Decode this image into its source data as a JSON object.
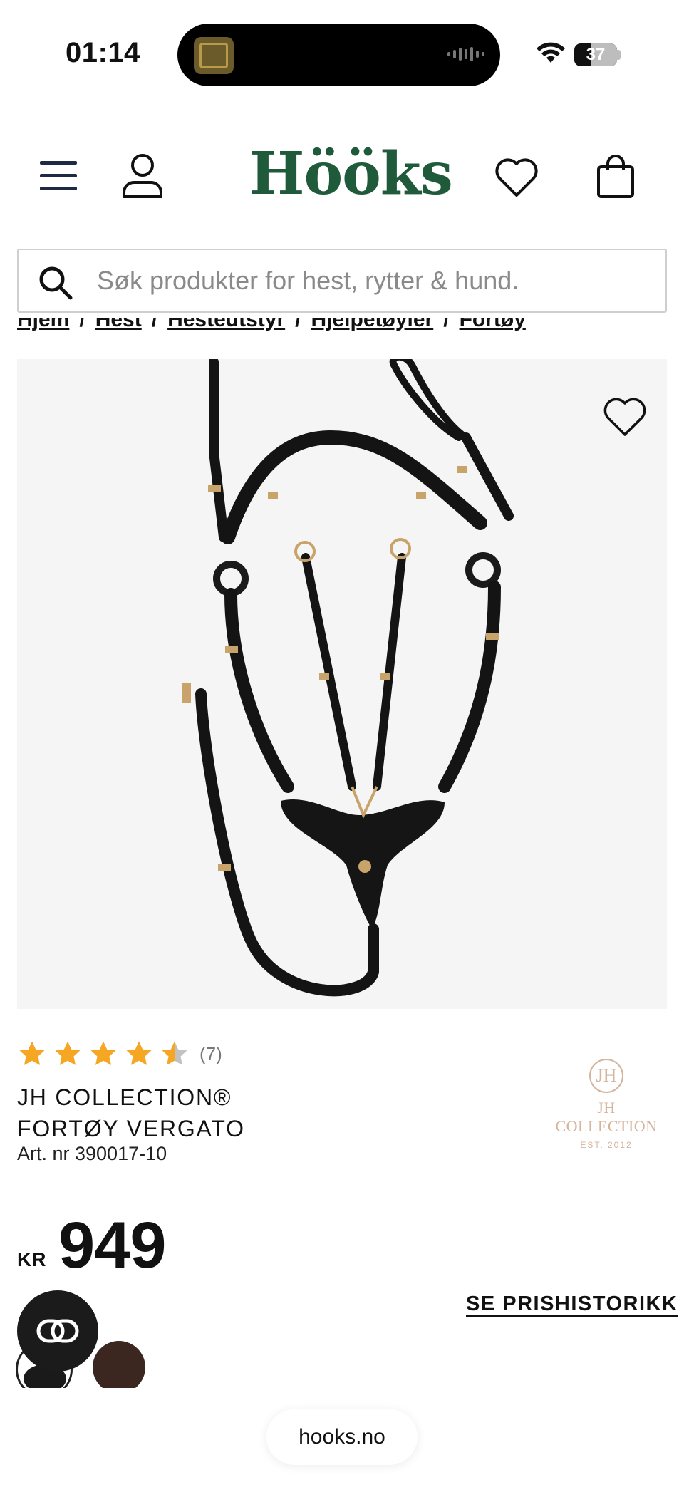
{
  "status": {
    "time": "01:14",
    "battery": "37"
  },
  "header": {
    "logo": "Hööks"
  },
  "search": {
    "placeholder": "Søk produkter for hest, rytter & hund."
  },
  "breadcrumb": [
    "Hjem",
    "Hest",
    "Hesteutstyr",
    "Hjelpetøyler",
    "Fortøy"
  ],
  "product": {
    "rating_stars": 4.5,
    "rating_count": "(7)",
    "title_line1": "JH COLLECTION®",
    "title_line2": "FORTØY VERGATO",
    "art_nr": "Art. nr 390017-10",
    "currency": "KR",
    "price": "949",
    "price_history": "SE PRISHISTORIKK",
    "brand_logo": {
      "monogram": "JH",
      "name": "JH COLLECTION",
      "est": "EST. 2012"
    },
    "swatch_colors": [
      "#1a1a1a",
      "#3b2620"
    ]
  },
  "browser": {
    "url": "hooks.no"
  },
  "colors": {
    "brand": "#1f5a3a",
    "star": "#f5a623"
  }
}
